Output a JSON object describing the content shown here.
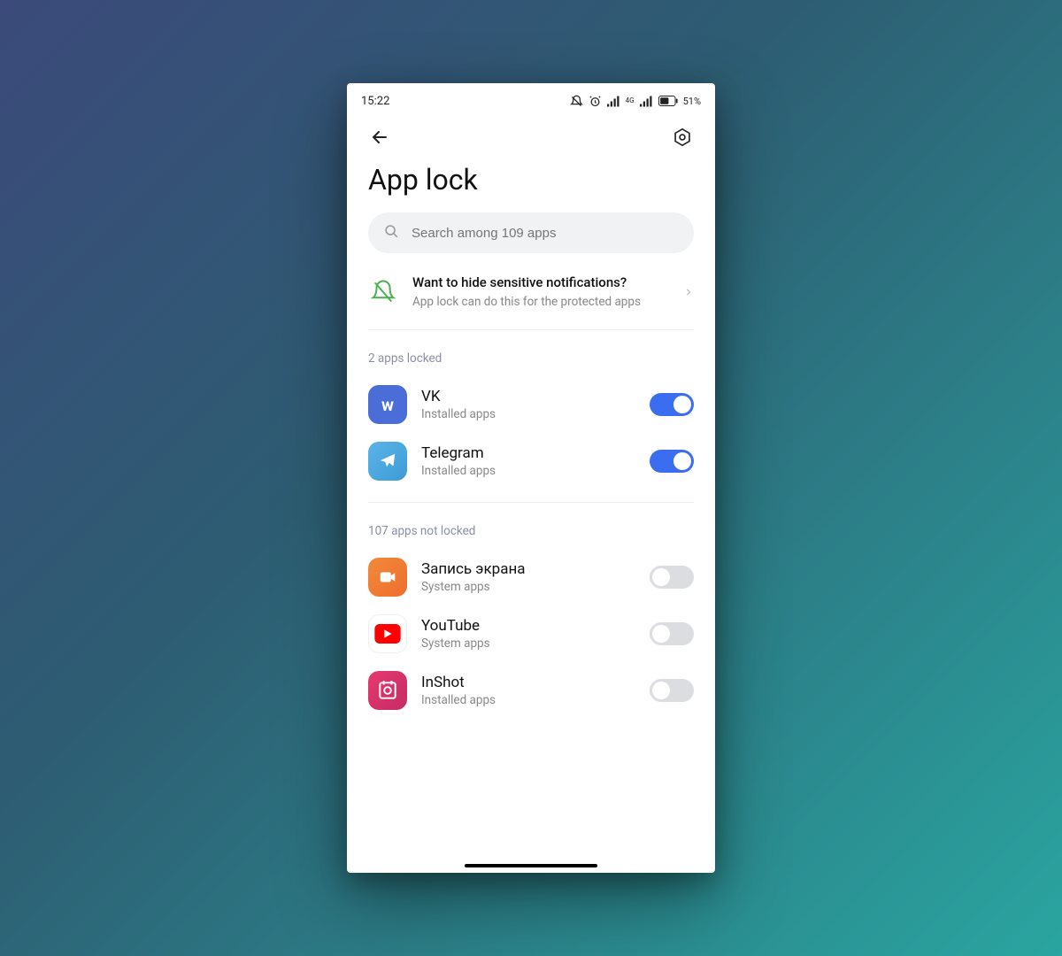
{
  "statusbar": {
    "time": "15:22",
    "battery": "51%",
    "network_label": "4G"
  },
  "header": {
    "title": "App lock"
  },
  "search": {
    "placeholder": "Search among 109 apps"
  },
  "banner": {
    "title": "Want to hide sensitive notifications?",
    "subtitle": "App lock can do this for the protected apps"
  },
  "sections": {
    "locked_label": "2 apps locked",
    "unlocked_label": "107 apps not locked"
  },
  "apps_locked": [
    {
      "name": "VK",
      "subtitle": "Installed apps",
      "icon": "vk",
      "locked": true
    },
    {
      "name": "Telegram",
      "subtitle": "Installed apps",
      "icon": "tg",
      "locked": true
    }
  ],
  "apps_unlocked": [
    {
      "name": "Запись экрана",
      "subtitle": "System apps",
      "icon": "rec",
      "locked": false
    },
    {
      "name": "YouTube",
      "subtitle": "System apps",
      "icon": "yt",
      "locked": false
    },
    {
      "name": "InShot",
      "subtitle": "Installed apps",
      "icon": "inshot",
      "locked": false
    }
  ]
}
